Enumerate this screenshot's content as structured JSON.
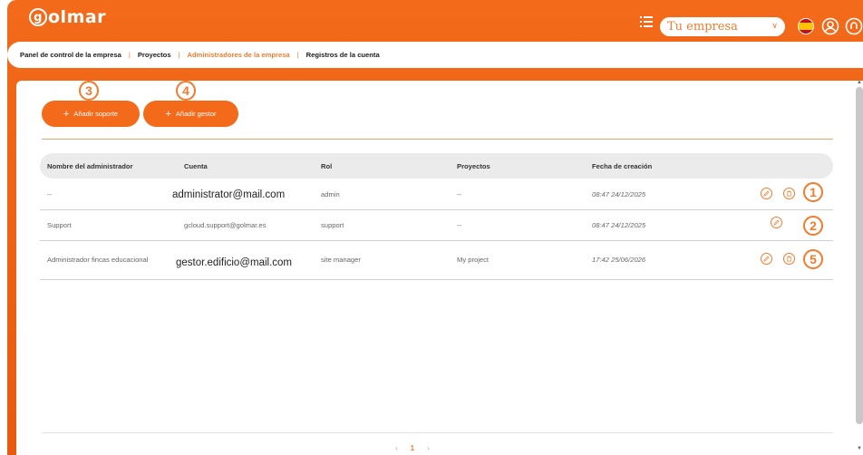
{
  "header": {
    "logo_text": "golmar",
    "company_select": {
      "value": "Tu empresa"
    }
  },
  "nav": {
    "items": [
      "Panel de control de la empresa",
      "Proyectos",
      "Administradores de la empresa",
      "Registros de la cuenta"
    ],
    "active_index": 2
  },
  "actions": {
    "add_support": "Añadir soporte",
    "add_manager": "Añadir gestor"
  },
  "callouts": [
    "3",
    "4",
    "1",
    "2",
    "5"
  ],
  "table": {
    "columns": [
      "Nombre del administrador",
      "Cuenta",
      "Rol",
      "Proyectos",
      "Fecha de creación"
    ],
    "rows": [
      {
        "name": "--",
        "account": "administrator@mail.com",
        "role": "admin",
        "projects": "--",
        "date": "08:47 24/12/2025"
      },
      {
        "name": "Support",
        "account": "gcloud.support@golmar.es",
        "role": "support",
        "projects": "--",
        "date": "08:47 24/12/2025"
      },
      {
        "name": "Administrador fincas educacional",
        "account": "gestor.edificio@mail.com",
        "role": "site manager",
        "projects": "My project",
        "date": "17:42 25/06/2026"
      }
    ]
  },
  "pagination": {
    "prev": "‹",
    "current": "1",
    "next": "›"
  },
  "colors": {
    "accent": "#f26a1a",
    "header_bg": "#ebebeb"
  }
}
